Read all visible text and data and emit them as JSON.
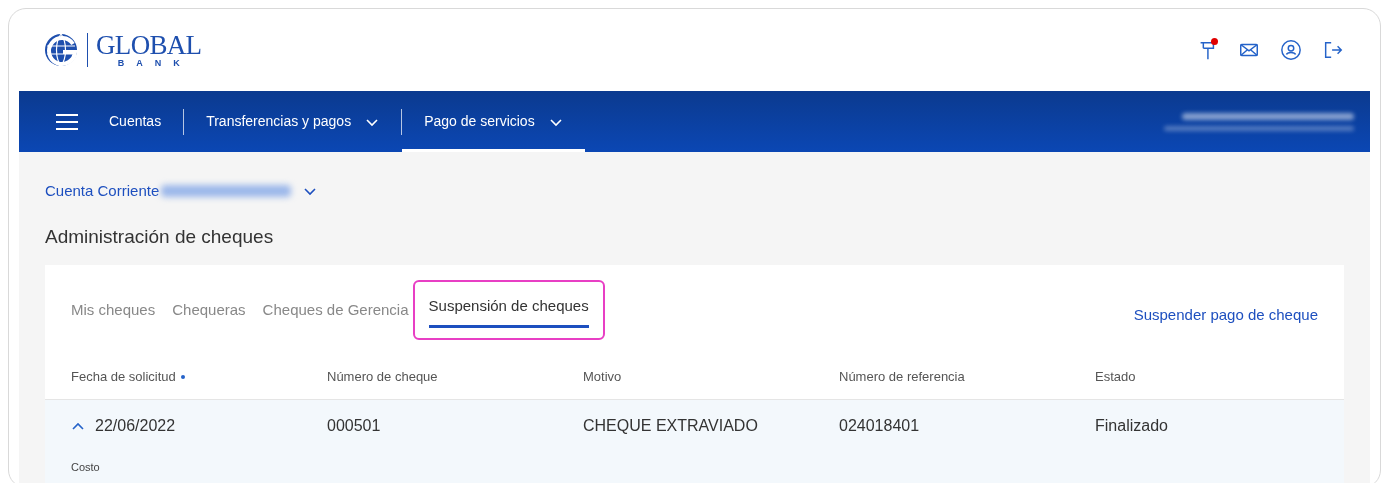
{
  "logo": {
    "name": "GLOBAL",
    "subtitle": "BANK"
  },
  "header_icons": [
    {
      "kind": "flag",
      "badge": true
    },
    {
      "kind": "mail",
      "badge": false
    },
    {
      "kind": "user",
      "badge": false
    },
    {
      "kind": "logout",
      "badge": false
    }
  ],
  "nav": {
    "items": [
      {
        "label": "Cuentas",
        "dropdown": false,
        "selected": false
      },
      {
        "label": "Transferencias y pagos",
        "dropdown": true,
        "selected": false
      },
      {
        "label": "Pago de servicios",
        "dropdown": true,
        "selected": true
      }
    ]
  },
  "account": {
    "label": "Cuenta Corriente"
  },
  "page_title": "Administración de cheques",
  "tabs": [
    {
      "label": "Mis cheques",
      "selected": false
    },
    {
      "label": "Chequeras",
      "selected": false
    },
    {
      "label": "Cheques de Gerencia",
      "selected": false
    },
    {
      "label": "Suspensión de cheques",
      "selected": true
    }
  ],
  "action_link": "Suspender pago de cheque",
  "table": {
    "columns": [
      {
        "label": "Fecha de solicitud",
        "sorted": true
      },
      {
        "label": "Número de cheque",
        "sorted": false
      },
      {
        "label": "Motivo",
        "sorted": false
      },
      {
        "label": "Número de referencia",
        "sorted": false
      },
      {
        "label": "Estado",
        "sorted": false
      }
    ],
    "rows": [
      {
        "expanded": true,
        "cells": [
          "22/06/2022",
          "000501",
          "CHEQUE EXTRAVIADO",
          "024018401",
          "Finalizado"
        ],
        "detail_label": "Costo"
      }
    ]
  }
}
